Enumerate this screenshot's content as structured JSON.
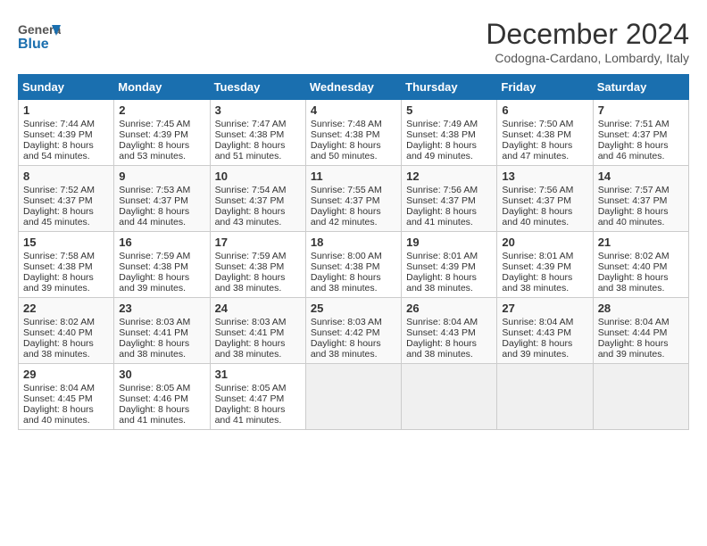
{
  "header": {
    "logo_general": "General",
    "logo_blue": "Blue",
    "title": "December 2024",
    "subtitle": "Codogna-Cardano, Lombardy, Italy"
  },
  "weekdays": [
    "Sunday",
    "Monday",
    "Tuesday",
    "Wednesday",
    "Thursday",
    "Friday",
    "Saturday"
  ],
  "weeks": [
    [
      {
        "day": "1",
        "lines": [
          "Sunrise: 7:44 AM",
          "Sunset: 4:39 PM",
          "Daylight: 8 hours",
          "and 54 minutes."
        ]
      },
      {
        "day": "2",
        "lines": [
          "Sunrise: 7:45 AM",
          "Sunset: 4:39 PM",
          "Daylight: 8 hours",
          "and 53 minutes."
        ]
      },
      {
        "day": "3",
        "lines": [
          "Sunrise: 7:47 AM",
          "Sunset: 4:38 PM",
          "Daylight: 8 hours",
          "and 51 minutes."
        ]
      },
      {
        "day": "4",
        "lines": [
          "Sunrise: 7:48 AM",
          "Sunset: 4:38 PM",
          "Daylight: 8 hours",
          "and 50 minutes."
        ]
      },
      {
        "day": "5",
        "lines": [
          "Sunrise: 7:49 AM",
          "Sunset: 4:38 PM",
          "Daylight: 8 hours",
          "and 49 minutes."
        ]
      },
      {
        "day": "6",
        "lines": [
          "Sunrise: 7:50 AM",
          "Sunset: 4:38 PM",
          "Daylight: 8 hours",
          "and 47 minutes."
        ]
      },
      {
        "day": "7",
        "lines": [
          "Sunrise: 7:51 AM",
          "Sunset: 4:37 PM",
          "Daylight: 8 hours",
          "and 46 minutes."
        ]
      }
    ],
    [
      {
        "day": "8",
        "lines": [
          "Sunrise: 7:52 AM",
          "Sunset: 4:37 PM",
          "Daylight: 8 hours",
          "and 45 minutes."
        ]
      },
      {
        "day": "9",
        "lines": [
          "Sunrise: 7:53 AM",
          "Sunset: 4:37 PM",
          "Daylight: 8 hours",
          "and 44 minutes."
        ]
      },
      {
        "day": "10",
        "lines": [
          "Sunrise: 7:54 AM",
          "Sunset: 4:37 PM",
          "Daylight: 8 hours",
          "and 43 minutes."
        ]
      },
      {
        "day": "11",
        "lines": [
          "Sunrise: 7:55 AM",
          "Sunset: 4:37 PM",
          "Daylight: 8 hours",
          "and 42 minutes."
        ]
      },
      {
        "day": "12",
        "lines": [
          "Sunrise: 7:56 AM",
          "Sunset: 4:37 PM",
          "Daylight: 8 hours",
          "and 41 minutes."
        ]
      },
      {
        "day": "13",
        "lines": [
          "Sunrise: 7:56 AM",
          "Sunset: 4:37 PM",
          "Daylight: 8 hours",
          "and 40 minutes."
        ]
      },
      {
        "day": "14",
        "lines": [
          "Sunrise: 7:57 AM",
          "Sunset: 4:37 PM",
          "Daylight: 8 hours",
          "and 40 minutes."
        ]
      }
    ],
    [
      {
        "day": "15",
        "lines": [
          "Sunrise: 7:58 AM",
          "Sunset: 4:38 PM",
          "Daylight: 8 hours",
          "and 39 minutes."
        ]
      },
      {
        "day": "16",
        "lines": [
          "Sunrise: 7:59 AM",
          "Sunset: 4:38 PM",
          "Daylight: 8 hours",
          "and 39 minutes."
        ]
      },
      {
        "day": "17",
        "lines": [
          "Sunrise: 7:59 AM",
          "Sunset: 4:38 PM",
          "Daylight: 8 hours",
          "and 38 minutes."
        ]
      },
      {
        "day": "18",
        "lines": [
          "Sunrise: 8:00 AM",
          "Sunset: 4:38 PM",
          "Daylight: 8 hours",
          "and 38 minutes."
        ]
      },
      {
        "day": "19",
        "lines": [
          "Sunrise: 8:01 AM",
          "Sunset: 4:39 PM",
          "Daylight: 8 hours",
          "and 38 minutes."
        ]
      },
      {
        "day": "20",
        "lines": [
          "Sunrise: 8:01 AM",
          "Sunset: 4:39 PM",
          "Daylight: 8 hours",
          "and 38 minutes."
        ]
      },
      {
        "day": "21",
        "lines": [
          "Sunrise: 8:02 AM",
          "Sunset: 4:40 PM",
          "Daylight: 8 hours",
          "and 38 minutes."
        ]
      }
    ],
    [
      {
        "day": "22",
        "lines": [
          "Sunrise: 8:02 AM",
          "Sunset: 4:40 PM",
          "Daylight: 8 hours",
          "and 38 minutes."
        ]
      },
      {
        "day": "23",
        "lines": [
          "Sunrise: 8:03 AM",
          "Sunset: 4:41 PM",
          "Daylight: 8 hours",
          "and 38 minutes."
        ]
      },
      {
        "day": "24",
        "lines": [
          "Sunrise: 8:03 AM",
          "Sunset: 4:41 PM",
          "Daylight: 8 hours",
          "and 38 minutes."
        ]
      },
      {
        "day": "25",
        "lines": [
          "Sunrise: 8:03 AM",
          "Sunset: 4:42 PM",
          "Daylight: 8 hours",
          "and 38 minutes."
        ]
      },
      {
        "day": "26",
        "lines": [
          "Sunrise: 8:04 AM",
          "Sunset: 4:43 PM",
          "Daylight: 8 hours",
          "and 38 minutes."
        ]
      },
      {
        "day": "27",
        "lines": [
          "Sunrise: 8:04 AM",
          "Sunset: 4:43 PM",
          "Daylight: 8 hours",
          "and 39 minutes."
        ]
      },
      {
        "day": "28",
        "lines": [
          "Sunrise: 8:04 AM",
          "Sunset: 4:44 PM",
          "Daylight: 8 hours",
          "and 39 minutes."
        ]
      }
    ],
    [
      {
        "day": "29",
        "lines": [
          "Sunrise: 8:04 AM",
          "Sunset: 4:45 PM",
          "Daylight: 8 hours",
          "and 40 minutes."
        ]
      },
      {
        "day": "30",
        "lines": [
          "Sunrise: 8:05 AM",
          "Sunset: 4:46 PM",
          "Daylight: 8 hours",
          "and 41 minutes."
        ]
      },
      {
        "day": "31",
        "lines": [
          "Sunrise: 8:05 AM",
          "Sunset: 4:47 PM",
          "Daylight: 8 hours",
          "and 41 minutes."
        ]
      },
      null,
      null,
      null,
      null
    ]
  ]
}
